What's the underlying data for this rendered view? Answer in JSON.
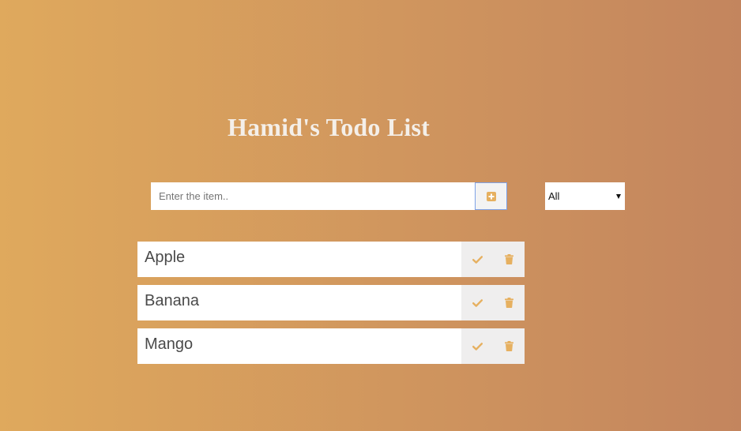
{
  "header": {
    "title": "Hamid's Todo List"
  },
  "form": {
    "placeholder": "Enter the item..",
    "value": "",
    "add_icon": "plus-square-icon"
  },
  "filter": {
    "selected": "All"
  },
  "todos": [
    {
      "text": "Apple",
      "complete_icon": "check-icon",
      "delete_icon": "trash-icon"
    },
    {
      "text": "Banana",
      "complete_icon": "check-icon",
      "delete_icon": "trash-icon"
    },
    {
      "text": "Mango",
      "complete_icon": "check-icon",
      "delete_icon": "trash-icon"
    }
  ],
  "colors": {
    "gradient_start": "#dfa95d",
    "gradient_end": "#c3855e",
    "accent": "#e6b060",
    "title": "#f4efe9",
    "button_bg": "#efeeee"
  }
}
